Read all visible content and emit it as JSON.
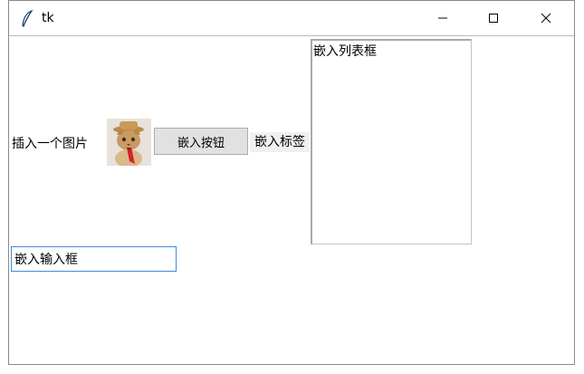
{
  "window": {
    "title": "tk",
    "icon": "feather-icon",
    "controls": [
      "minimize-icon",
      "maximize-icon",
      "close-icon"
    ]
  },
  "content": {
    "image_label": "插入一个图片",
    "image_subject": "cat-image",
    "button_label": "嵌入按钮",
    "embedded_label": "嵌入标签",
    "listbox": {
      "items": [
        "嵌入列表框"
      ]
    },
    "entry": {
      "value": "嵌入输入框"
    }
  },
  "colors": {
    "button_bg": "#e1e1e1",
    "label_bg": "#f0f0f0",
    "entry_focus_border": "#3c8ddb",
    "window_bg": "#ffffff"
  }
}
